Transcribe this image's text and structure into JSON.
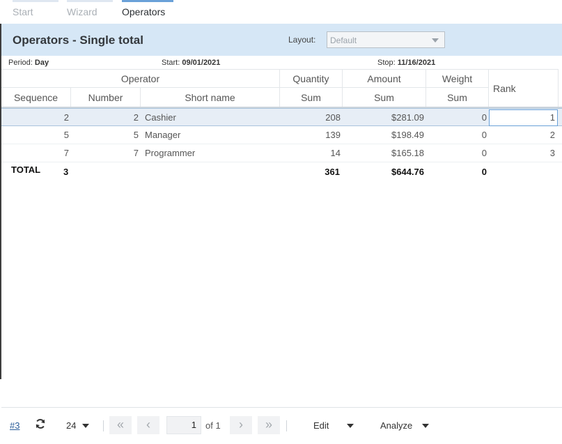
{
  "tabs": [
    {
      "label": "Start",
      "active": false
    },
    {
      "label": "Wizard",
      "active": false
    },
    {
      "label": "Operators",
      "active": true
    }
  ],
  "header": {
    "title": "Operators - Single total",
    "layout_label": "Layout:",
    "layout_value": "Default"
  },
  "period": {
    "period_label": "Period:",
    "period_value": "Day",
    "start_label": "Start:",
    "start_value": "09/01/2021",
    "stop_label": "Stop:",
    "stop_value": "11/16/2021"
  },
  "table": {
    "group_headers": {
      "operator": "Operator",
      "quantity": "Quantity",
      "amount": "Amount",
      "weight": "Weight",
      "rank": "Rank"
    },
    "sub_headers": {
      "sequence": "Sequence",
      "number": "Number",
      "short_name": "Short name",
      "quantity_sum": "Sum",
      "amount_sum": "Sum",
      "weight_sum": "Sum"
    },
    "rows": [
      {
        "sequence": "2",
        "number": "2",
        "short_name": "Cashier",
        "quantity": "208",
        "amount": "$281.09",
        "weight": "0",
        "rank": "1"
      },
      {
        "sequence": "5",
        "number": "5",
        "short_name": "Manager",
        "quantity": "139",
        "amount": "$198.49",
        "weight": "0",
        "rank": "2"
      },
      {
        "sequence": "7",
        "number": "7",
        "short_name": "Programmer",
        "quantity": "14",
        "amount": "$165.18",
        "weight": "0",
        "rank": "3"
      }
    ],
    "total": {
      "label": "TOTAL",
      "count": "3",
      "quantity": "361",
      "amount": "$644.76",
      "weight": "0"
    }
  },
  "footer": {
    "link": "#3",
    "page_size": "24",
    "page_current": "1",
    "page_of": "of 1",
    "edit_label": "Edit",
    "analyze_label": "Analyze"
  },
  "icons": {
    "refresh": "refresh-icon",
    "first": "double-chevron-left-icon",
    "prev": "chevron-left-icon",
    "next": "chevron-right-icon",
    "last": "double-chevron-right-icon",
    "dropdown": "caret-down-icon"
  },
  "colors": {
    "accent": "#6aa1d8",
    "header_band": "#d6e7f6",
    "selected_row": "#e7eef6",
    "link": "#2a5d9a"
  }
}
